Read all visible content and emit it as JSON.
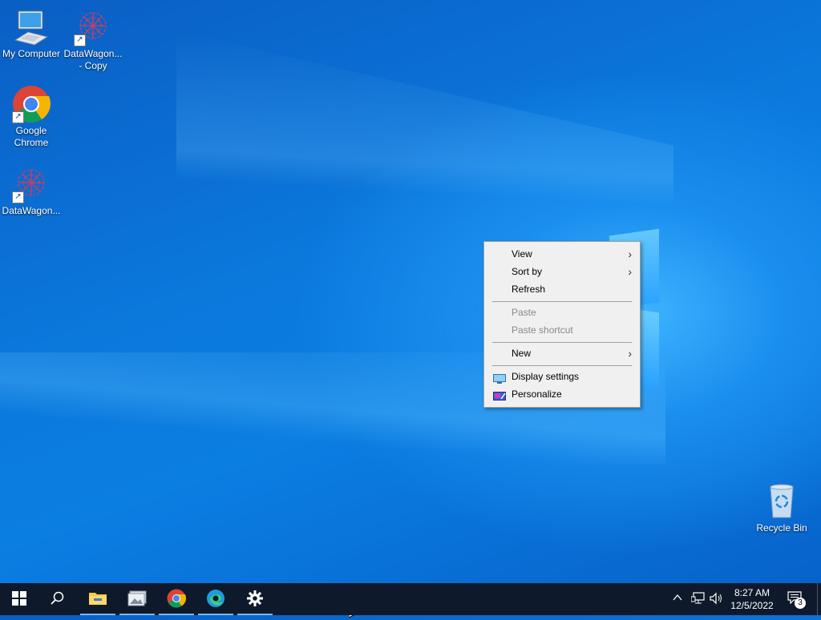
{
  "desktop": {
    "icons": [
      {
        "label": "My Computer",
        "icon": "computer-icon"
      },
      {
        "label": "DataWagon... - Copy",
        "icon": "datawagon-icon"
      },
      {
        "label": "Google Chrome",
        "icon": "chrome-icon"
      },
      {
        "label": "DataWagon...",
        "icon": "datawagon-icon"
      },
      {
        "label": "Recycle Bin",
        "icon": "recycle-bin-icon"
      }
    ]
  },
  "context_menu": {
    "items": [
      {
        "label": "View",
        "submenu": true,
        "enabled": true
      },
      {
        "label": "Sort by",
        "submenu": true,
        "enabled": true
      },
      {
        "label": "Refresh",
        "submenu": false,
        "enabled": true
      },
      {
        "label": "Paste",
        "submenu": false,
        "enabled": false
      },
      {
        "label": "Paste shortcut",
        "submenu": false,
        "enabled": false
      },
      {
        "label": "New",
        "submenu": true,
        "enabled": true
      },
      {
        "label": "Display settings",
        "submenu": false,
        "enabled": true,
        "icon": "display-settings-icon"
      },
      {
        "label": "Personalize",
        "submenu": false,
        "enabled": true,
        "icon": "personalize-icon"
      }
    ],
    "chevron": "›"
  },
  "taskbar": {
    "apps": [
      {
        "name": "start",
        "icon": "windows-start-icon"
      },
      {
        "name": "search",
        "icon": "search-icon"
      },
      {
        "name": "file-explorer",
        "icon": "folder-icon",
        "running": true
      },
      {
        "name": "photos",
        "icon": "photos-icon",
        "running": true
      },
      {
        "name": "chrome",
        "icon": "chrome-icon",
        "running": true
      },
      {
        "name": "edge",
        "icon": "edge-icon",
        "running": true
      },
      {
        "name": "settings",
        "icon": "gear-icon",
        "running": true
      }
    ],
    "clock_time": "8:27 AM",
    "clock_date": "12/5/2022",
    "notification_count": "3"
  },
  "colors": {
    "taskbar_bg": "#0e1a2b",
    "menu_bg": "#f0f0f0",
    "accent": "#76b9ed"
  }
}
